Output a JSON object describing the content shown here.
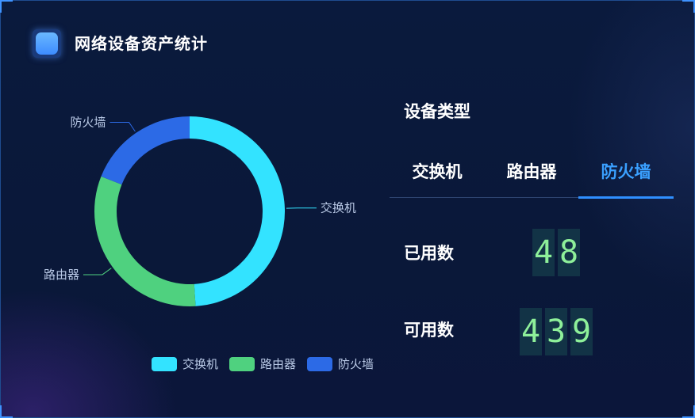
{
  "header": {
    "title": "网络设备资产统计",
    "icon": "app-square-icon"
  },
  "chart_data": {
    "type": "pie",
    "variant": "donut",
    "labels": [
      "交换机",
      "路由器",
      "防火墙"
    ],
    "values": [
      49,
      32,
      19
    ],
    "colors": [
      "#33e3ff",
      "#4fd17f",
      "#2c6ae6"
    ],
    "legend_position": "bottom"
  },
  "device_panel": {
    "heading": "设备类型",
    "tabs": [
      "交换机",
      "路由器",
      "防火墙"
    ],
    "active_tab_index": 2,
    "used_label": "已用数",
    "used_value": "48",
    "available_label": "可用数",
    "available_value": "439"
  },
  "colors": {
    "accent": "#2f8fff",
    "active_tab": "#3aa0ff",
    "digit_text": "#8ef09a",
    "background": "#0a1a3d"
  }
}
